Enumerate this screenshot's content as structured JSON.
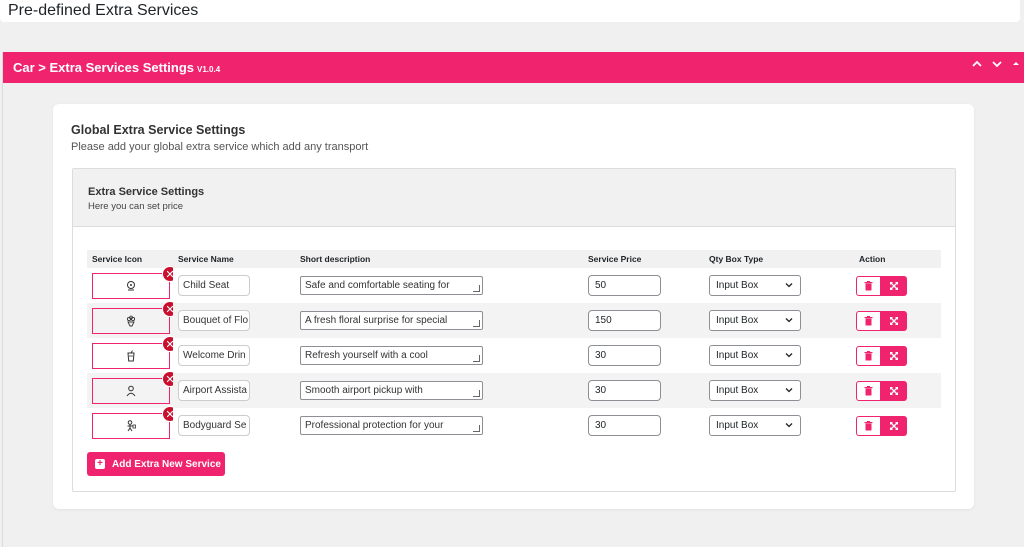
{
  "page": {
    "title": "Pre-defined Extra Services"
  },
  "metabox": {
    "title": "Car > Extra Services Settings",
    "version": "V1.0.4",
    "controls": {
      "up": "▲",
      "down": "▼",
      "toggle": "▴"
    }
  },
  "global": {
    "title": "Global Extra Service Settings",
    "subtitle": "Please add your global extra service which add any transport"
  },
  "panel": {
    "title": "Extra Service Settings",
    "subtitle": "Here you can set price"
  },
  "table": {
    "headers": {
      "icon": "Service Icon",
      "name": "Service Name",
      "desc": "Short description",
      "price": "Service Price",
      "qty": "Qty Box Type",
      "action": "Action"
    },
    "rows": [
      {
        "icon": "child-seat-icon",
        "name": "Child Seat",
        "desc": "Safe and comfortable seating for",
        "price": "50",
        "qty": "Input Box"
      },
      {
        "icon": "flowers-icon",
        "name": "Bouquet of Flo",
        "desc": "A fresh floral surprise for special",
        "price": "150",
        "qty": "Input Box"
      },
      {
        "icon": "drink-icon",
        "name": "Welcome Drin",
        "desc": "Refresh yourself with a cool",
        "price": "30",
        "qty": "Input Box"
      },
      {
        "icon": "person-icon",
        "name": "Airport Assista",
        "desc": "Smooth airport pickup with",
        "price": "30",
        "qty": "Input Box"
      },
      {
        "icon": "bodyguard-icon",
        "name": "Bodyguard Se",
        "desc": "Professional protection for your",
        "price": "30",
        "qty": "Input Box"
      }
    ]
  },
  "add_button": {
    "label": "Add Extra New Service"
  },
  "colors": {
    "accent": "#f0246e",
    "remove": "#c8102e"
  }
}
